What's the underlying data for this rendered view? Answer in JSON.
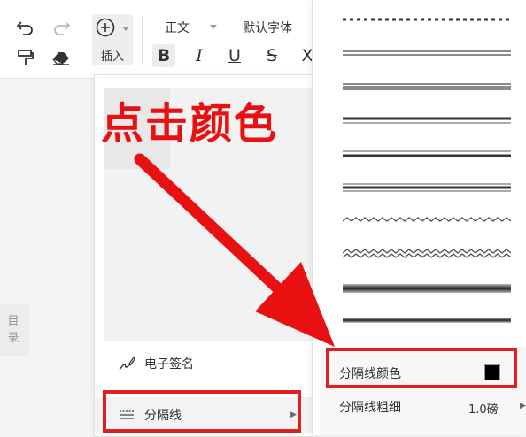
{
  "toolbar": {
    "insert_label": "插入",
    "style_value": "正文",
    "font_value": "默认字体",
    "format": {
      "bold": "B",
      "italic": "I",
      "underline": "U",
      "strike": "S",
      "clear": "X"
    }
  },
  "side_tab": {
    "label_line1": "目",
    "label_line2": "录"
  },
  "insert_menu": {
    "items": [
      {
        "label": "电子签名",
        "icon": "signature-pen-icon"
      },
      {
        "label": "分隔线",
        "icon": "separator-lines-icon"
      }
    ]
  },
  "submenu": {
    "line_styles": [
      "dotted",
      "double-thin",
      "triple-thin",
      "thick-thin",
      "thin-thick",
      "thin-thick-thin",
      "wavy",
      "double-wavy",
      "gradient-thick",
      "gradient-thin"
    ],
    "color_label": "分隔线颜色",
    "color_value": "#000000",
    "weight_label": "分隔线粗细",
    "weight_value": "1.0磅"
  },
  "annotation": {
    "text": "点击颜色",
    "color": "#e02020"
  },
  "colors": {
    "accent_red": "#e02020",
    "toolbar_bg": "#ffffff",
    "canvas_bg": "#f5f5f5"
  }
}
